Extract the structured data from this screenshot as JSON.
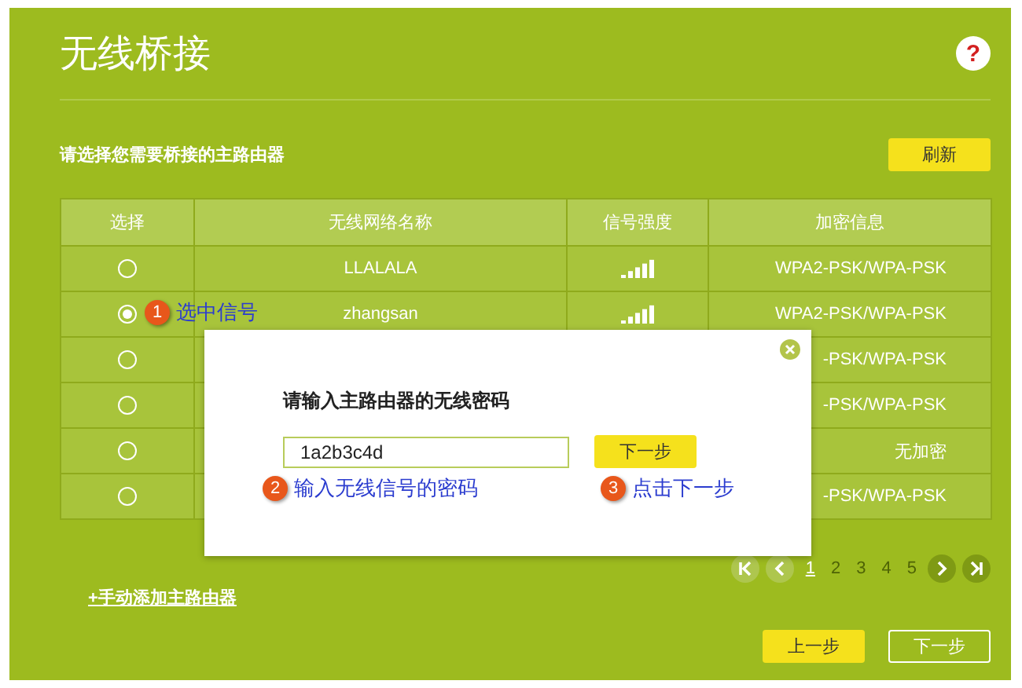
{
  "title": "无线桥接",
  "help": "?",
  "subtitle": "请选择您需要桥接的主路由器",
  "refresh": "刷新",
  "table": {
    "columns": [
      "选择",
      "无线网络名称",
      "信号强度",
      "加密信息"
    ],
    "rows": [
      {
        "selected": false,
        "name": "LLALALA",
        "signal": true,
        "security": "WPA2-PSK/WPA-PSK"
      },
      {
        "selected": true,
        "name": "zhangsan",
        "signal": true,
        "security": "WPA2-PSK/WPA-PSK"
      },
      {
        "selected": false,
        "security": "-PSK/WPA-PSK"
      },
      {
        "selected": false,
        "security": "-PSK/WPA-PSK"
      },
      {
        "selected": false,
        "security": "无加密"
      },
      {
        "selected": false,
        "security": "-PSK/WPA-PSK"
      }
    ]
  },
  "pager": [
    {
      "label": "1",
      "selected": true
    },
    {
      "label": "2",
      "selected": false
    },
    {
      "label": "3",
      "selected": false
    },
    {
      "label": "4",
      "selected": false
    },
    {
      "label": "5",
      "selected": false
    }
  ],
  "add_link": "+手动添加主路由器",
  "buttons": [
    {
      "label": "上一步",
      "kind": "primary"
    },
    {
      "label": "下一步",
      "kind": "outline"
    }
  ],
  "dialog": {
    "title": "请输入主路由器的无线密码",
    "value": "1a2b3c4d",
    "button": "下一步"
  },
  "annotations": [
    {
      "number": "1",
      "text": "选中信号"
    },
    {
      "number": "2",
      "text": "输入无线信号的密码"
    },
    {
      "number": "3",
      "text": "点击下一步"
    }
  ]
}
